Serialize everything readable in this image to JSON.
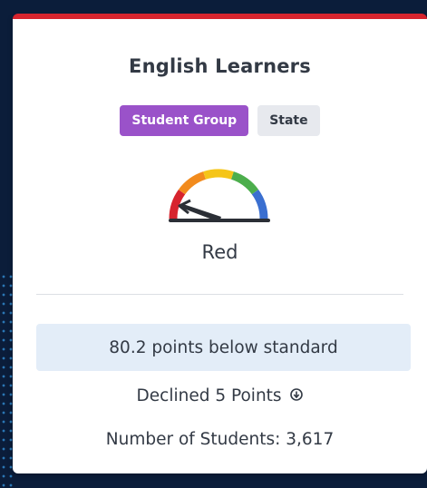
{
  "card": {
    "title": "English Learners",
    "tags": {
      "student_group": "Student Group",
      "state": "State"
    },
    "gauge": {
      "label": "Red",
      "level": 1,
      "segments": 5,
      "colors": [
        "#d7242e",
        "#f28b1d",
        "#f5c518",
        "#4cae4c",
        "#3a6fd0"
      ],
      "icon": "gauge-needle-icon"
    },
    "status": "80.2 points below standard",
    "change": {
      "text": "Declined 5 Points",
      "icon": "circle-down-arrow-icon"
    },
    "students": "Number of Students: 3,617"
  },
  "colors": {
    "accent_top": "#d7242e",
    "tag_group_bg": "#9a52c9",
    "tag_state_bg": "#e7e9ee",
    "status_bg": "#e3edf8",
    "page_bg": "#0b1d3a"
  }
}
